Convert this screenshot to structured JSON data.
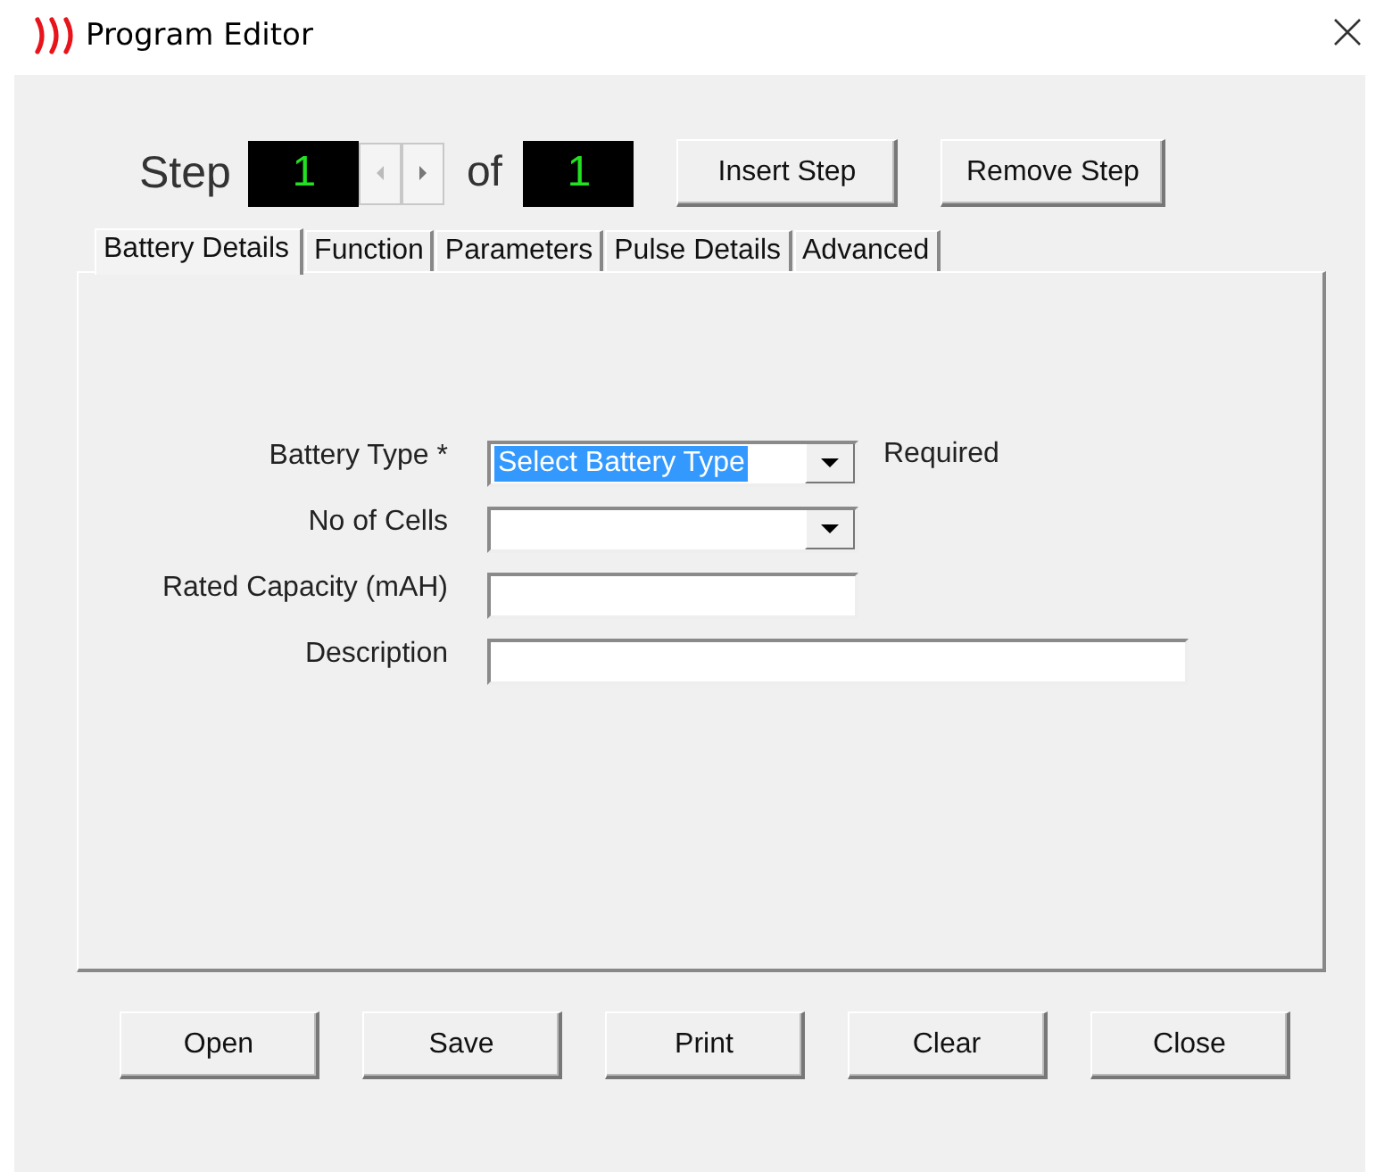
{
  "window": {
    "title": "Program Editor"
  },
  "step": {
    "label": "Step",
    "current": "1",
    "of_label": "of",
    "total": "1",
    "prev_disabled": true,
    "next_disabled": false
  },
  "step_buttons": [
    "Insert Step",
    "Remove Step"
  ],
  "tabs": [
    {
      "label": "Battery Details",
      "selected": true
    },
    {
      "label": "Function",
      "selected": false
    },
    {
      "label": "Parameters",
      "selected": false
    },
    {
      "label": "Pulse Details",
      "selected": false
    },
    {
      "label": "Advanced",
      "selected": false
    }
  ],
  "fields": [
    {
      "kind": "dropdown",
      "label": "Battery Type *",
      "value": "Select Battery Type",
      "highlighted": true,
      "note": "Required"
    },
    {
      "kind": "dropdown",
      "label": "No of Cells"
    },
    {
      "kind": "text",
      "label": "Rated Capacity (mAH)"
    },
    {
      "kind": "wide-text",
      "label": "Description"
    }
  ],
  "buttons": [
    "Open",
    "Save",
    "Print",
    "Clear",
    "Close"
  ]
}
